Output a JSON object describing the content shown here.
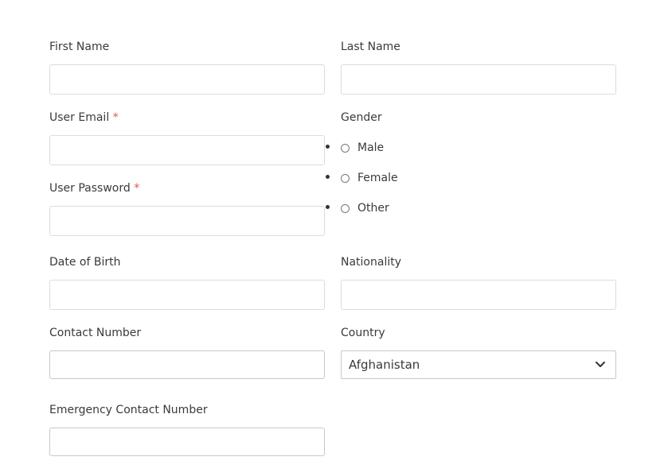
{
  "form": {
    "first_name": {
      "label": "First Name",
      "value": ""
    },
    "last_name": {
      "label": "Last Name",
      "value": ""
    },
    "user_email": {
      "label": "User Email",
      "required_mark": "*",
      "value": ""
    },
    "user_password": {
      "label": "User Password",
      "required_mark": "*",
      "value": ""
    },
    "gender": {
      "label": "Gender",
      "options": [
        "Male",
        "Female",
        "Other"
      ]
    },
    "date_of_birth": {
      "label": "Date of Birth",
      "value": ""
    },
    "nationality": {
      "label": "Nationality",
      "value": ""
    },
    "contact_number": {
      "label": "Contact Number",
      "value": ""
    },
    "country": {
      "label": "Country",
      "selected": "Afghanistan",
      "icon": "chevron-down-icon"
    },
    "emergency_contact": {
      "label": "Emergency Contact Number",
      "value": ""
    }
  }
}
